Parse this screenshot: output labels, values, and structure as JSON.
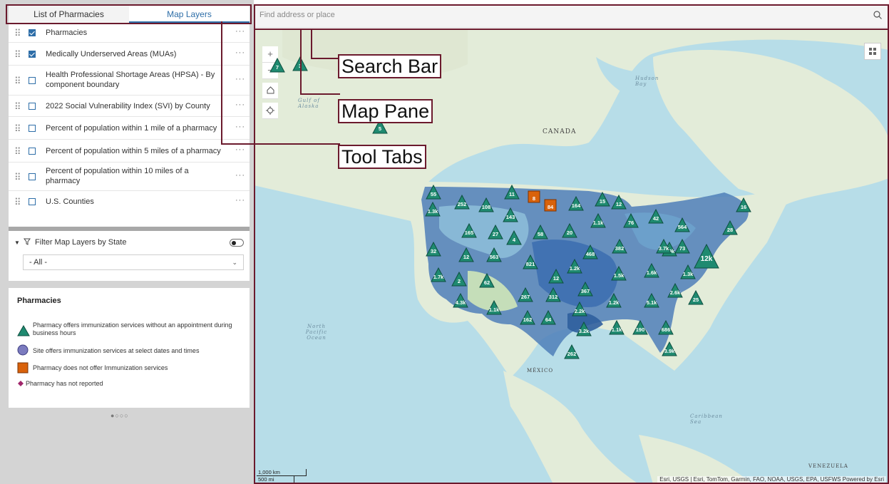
{
  "tabs": [
    {
      "label": "List of Pharmacies",
      "active": false
    },
    {
      "label": "Map Layers",
      "active": true
    }
  ],
  "layers": [
    {
      "label": "Pharmacies",
      "checked": true
    },
    {
      "label": "Medically Underserved Areas (MUAs)",
      "checked": true
    },
    {
      "label": "Health Professional Shortage Areas (HPSA) - By component boundary",
      "checked": false
    },
    {
      "label": "2022 Social Vulnerability Index (SVI) by County",
      "checked": false
    },
    {
      "label": "Percent of population within 1 mile of a pharmacy",
      "checked": false
    },
    {
      "label": "Percent of population within 5 miles of a pharmacy",
      "checked": false
    },
    {
      "label": "Percent of population within 10 miles of a pharmacy",
      "checked": false
    },
    {
      "label": "U.S. Counties",
      "checked": false
    }
  ],
  "filter": {
    "label": "Filter Map Layers by State",
    "toggle_on": false,
    "selected": "- All -"
  },
  "legend": {
    "title": "Pharmacies",
    "items": [
      {
        "label": "Pharmacy offers immunization services without an appointment during business hours",
        "symbol": "triangle",
        "color": "#1f8a70"
      },
      {
        "label": "Site offers immunization services at select dates and times",
        "symbol": "circle",
        "color": "#7b7bbf"
      },
      {
        "label": "Pharmacy does not offer Immunization services",
        "symbol": "square",
        "color": "#d9620b"
      },
      {
        "label": "Pharmacy has not reported",
        "symbol": "diamond",
        "color": "#a0266b"
      }
    ]
  },
  "pagination": "●○○○",
  "search": {
    "placeholder": "Find address or place"
  },
  "map": {
    "zoom_in": "+",
    "zoom_out": "−",
    "labels": {
      "canada": "CANADA",
      "mexico": "MÉXICO",
      "venezuela": "VENEZUELA",
      "hudson": "Hudson Bay",
      "gulf": "Gulf of Alaska",
      "pacific": "North Pacific Ocean",
      "caribbean": "Caribbean Sea"
    },
    "scale_km": "1,000 km",
    "scale_mi": "500 mi",
    "attribution": "Esri, USGS | Esri, TomTom, Garmin, FAO, NOAA, USGS, EPA, USFWS   Powered by Esri",
    "clusters": [
      "55",
      "252",
      "108",
      "11",
      "8",
      "84",
      "164",
      "15",
      "12",
      "16",
      "1.3k",
      "143",
      "165",
      "27",
      "4",
      "58",
      "20",
      "1.1k",
      "76",
      "42",
      "28",
      "564",
      "32",
      "12",
      "563",
      "468",
      "382",
      "3.9k",
      "3.7k",
      "73",
      "12k",
      "821",
      "1.2k",
      "1.5k",
      "1.6k",
      "1.3k",
      "1.7k",
      "2",
      "62",
      "12",
      "367",
      "2.6k",
      "25",
      "4.3k",
      "1.1k",
      "267",
      "312",
      "1.2k",
      "5.1k",
      "162",
      "64",
      "2.2k",
      "1.1k",
      "190",
      "686",
      "3.2k",
      "262",
      "3.9k",
      "5",
      "7",
      "3"
    ],
    "accent_color": "#1f8a70",
    "no_service_color": "#d9620b"
  },
  "annotations": {
    "search_bar": "Search Bar",
    "map_pane": "Map Pane",
    "tool_tabs": "Tool Tabs"
  },
  "colors": {
    "frame": "#6b1a2d",
    "accent": "#2e6ea8"
  }
}
